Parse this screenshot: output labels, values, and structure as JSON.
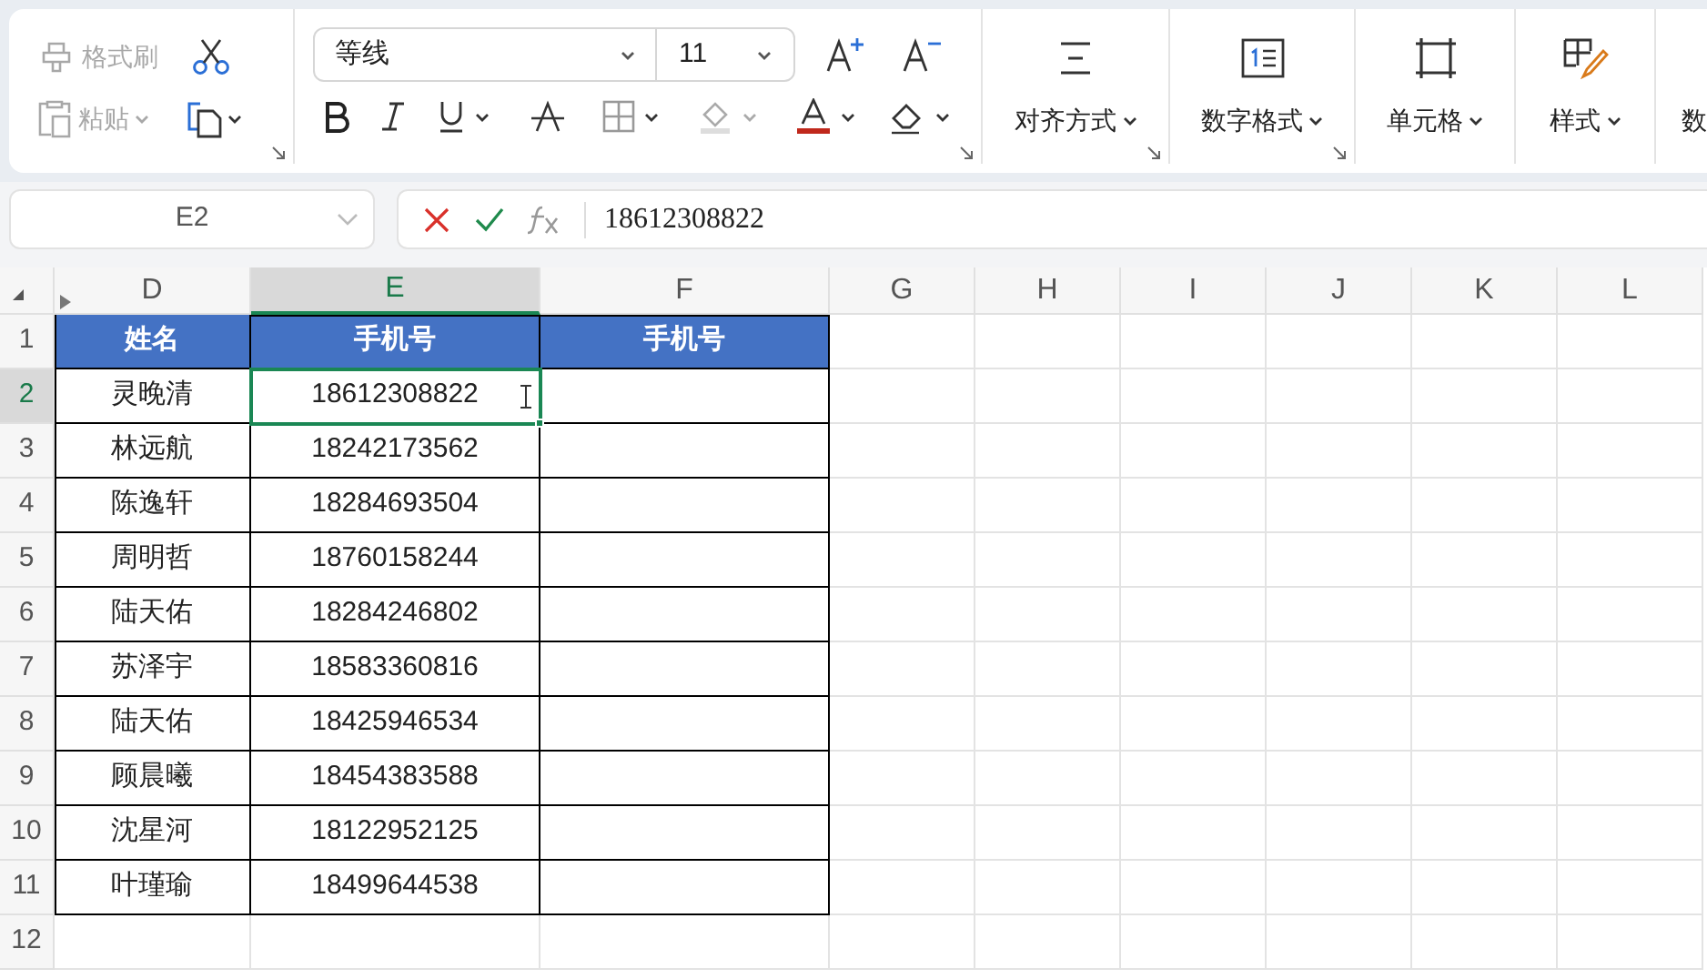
{
  "clipboard": {
    "format_painter": {
      "label": "格式刷",
      "disabled": true
    },
    "paste": {
      "label": "粘贴",
      "disabled": true
    }
  },
  "font": {
    "name": "等线",
    "size": "11"
  },
  "groups": [
    {
      "kind": "align",
      "label": "对齐方式"
    },
    {
      "kind": "number",
      "label": "数字格式"
    },
    {
      "kind": "cells",
      "label": "单元格"
    },
    {
      "kind": "style",
      "label": "样式"
    },
    {
      "kind": "cut",
      "label": "数"
    }
  ],
  "name_box": "E2",
  "formula": "18612308822",
  "columns": [
    {
      "label": "D",
      "selected": false
    },
    {
      "label": "E",
      "selected": true
    },
    {
      "label": "F",
      "selected": false
    },
    {
      "label": "G",
      "selected": false
    },
    {
      "label": "H",
      "selected": false
    },
    {
      "label": "I",
      "selected": false
    },
    {
      "label": "J",
      "selected": false
    },
    {
      "label": "K",
      "selected": false
    },
    {
      "label": "L",
      "selected": false
    }
  ],
  "rows": [
    {
      "number": "1",
      "kind": "header",
      "selected": false,
      "cells": [
        "姓名",
        "手机号",
        "手机号"
      ]
    },
    {
      "number": "2",
      "kind": "data",
      "selected": true,
      "cells": [
        "灵晚清",
        "18612308822"
      ]
    },
    {
      "number": "3",
      "kind": "data",
      "selected": false,
      "cells": [
        "林远航",
        "18242173562"
      ]
    },
    {
      "number": "4",
      "kind": "data",
      "selected": false,
      "cells": [
        "陈逸轩",
        "18284693504"
      ]
    },
    {
      "number": "5",
      "kind": "data",
      "selected": false,
      "cells": [
        "周明哲",
        "18760158244"
      ]
    },
    {
      "number": "6",
      "kind": "data",
      "selected": false,
      "cells": [
        "陆天佑",
        "18284246802"
      ]
    },
    {
      "number": "7",
      "kind": "data",
      "selected": false,
      "cells": [
        "苏泽宇",
        "18583360816"
      ]
    },
    {
      "number": "8",
      "kind": "data",
      "selected": false,
      "cells": [
        "陆天佑",
        "18425946534"
      ]
    },
    {
      "number": "9",
      "kind": "data",
      "selected": false,
      "cells": [
        "顾晨曦",
        "18454383588"
      ]
    },
    {
      "number": "10",
      "kind": "data",
      "selected": false,
      "cells": [
        "沈星河",
        "18122952125"
      ]
    },
    {
      "number": "11",
      "kind": "data",
      "selected": false,
      "cells": [
        "叶瑾瑜",
        "18499644538"
      ]
    },
    {
      "number": "12",
      "kind": "empty",
      "selected": false
    }
  ]
}
